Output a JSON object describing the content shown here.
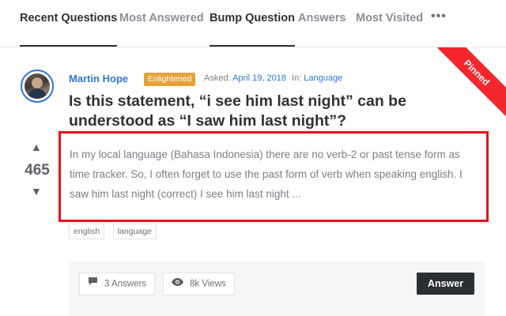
{
  "tabs": [
    {
      "label": "Recent Questions",
      "active": true
    },
    {
      "label": "Most Answered",
      "active": false
    },
    {
      "label": "Bump Question",
      "active": true
    },
    {
      "label": "Answers",
      "active": false
    },
    {
      "label": "Most Visited",
      "active": false
    }
  ],
  "more_label": "•••",
  "question": {
    "ribbon": "Pinned",
    "author": "Martin Hope",
    "badge": "Enlightened",
    "asked_label": "Asked:",
    "asked_date": "April 19, 2018",
    "in_label": "In:",
    "category": "Language",
    "title": "Is this statement, “i see him last night” can be understood as “I saw him last night”?",
    "votes": "465",
    "excerpt": "In my local language (Bahasa Indonesia) there are no verb-2 or past tense form as time tracker. So, I often forget to use the past form of verb when speaking english. I saw him last night (correct) I see him last night ...",
    "tags": [
      "english",
      "language"
    ],
    "answers_count": "3 Answers",
    "views_count": "8k Views",
    "answer_button": "Answer"
  },
  "colors": {
    "accent": "#2f77d7",
    "badge": "#e6a23a",
    "ribbon": "#f3262c",
    "highlight_border": "#e5141d",
    "dark_button": "#2b2e33"
  },
  "icons": {
    "vote_up": "triangle-up-icon",
    "vote_down": "triangle-down-icon",
    "answers": "comment-icon",
    "views": "eye-icon",
    "more": "ellipsis-icon"
  }
}
